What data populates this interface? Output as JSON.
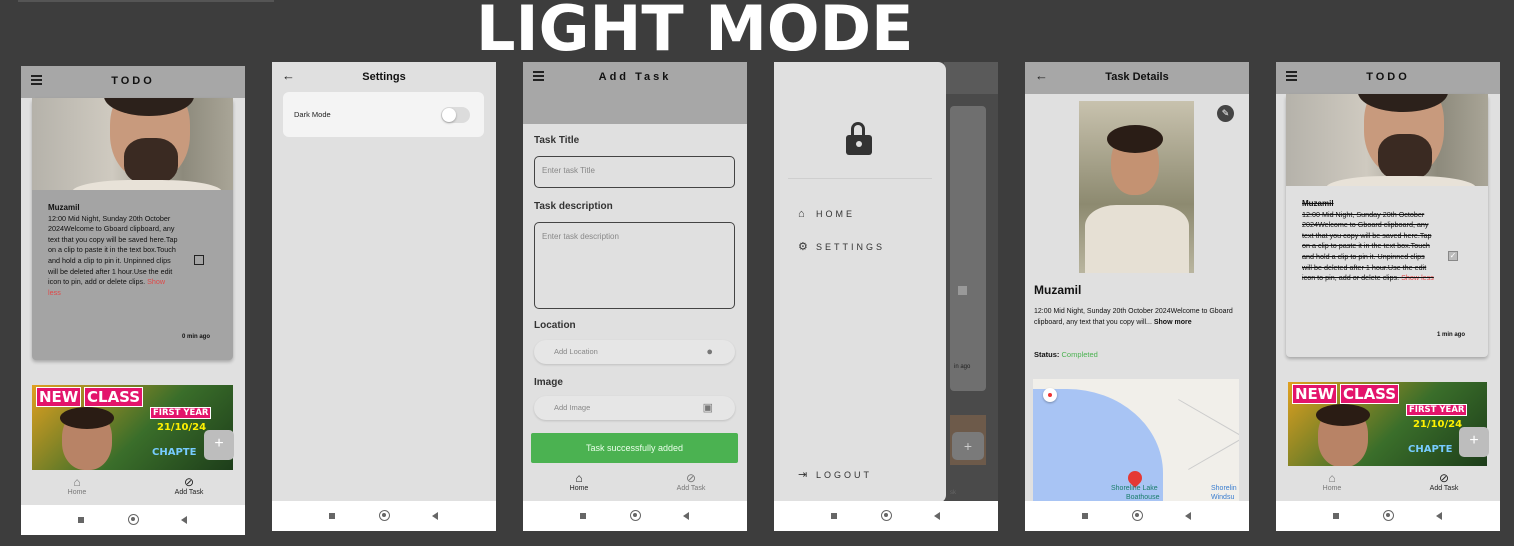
{
  "heading": "LIGHT MODE",
  "screen1": {
    "title": "TODO",
    "card": {
      "name": "Muzamil",
      "text": "12:00 Mid Night, Sunday 20th October 2024Welcome to Gboard clipboard, any text that you copy will be saved here.Tap on a clip to paste it in the text box.Touch and hold a clip to pin it. Unpinned clips will be deleted after 1 hour.Use the edit icon to pin, add or delete clips.",
      "toggle": "Show less",
      "time": "0 min ago"
    },
    "banner": {
      "w1": "NEW",
      "w2": "CLASS",
      "year": "FIRST YEAR",
      "date": "21/10/24",
      "chapter": "CHAPTE"
    },
    "fab": "+",
    "nav": {
      "home": "Home",
      "add": "Add Task"
    }
  },
  "screen2": {
    "title": "Settings",
    "dark_mode_label": "Dark Mode"
  },
  "screen3": {
    "title": "Add Task",
    "task_title_label": "Task Title",
    "task_title_placeholder": "Enter task Title",
    "desc_label": "Task description",
    "desc_placeholder": "Enter task description",
    "location_label": "Location",
    "location_placeholder": "Add Location",
    "image_label": "Image",
    "image_placeholder": "Add Image",
    "toast": "Task successfully added",
    "nav": {
      "home": "Home",
      "add": "Add Task"
    }
  },
  "screen4": {
    "home": "HOME",
    "settings": "SETTINGS",
    "logout": "LOGOUT",
    "peek_time": "in ago",
    "peek_nav": "sk"
  },
  "screen5": {
    "title": "Task Details",
    "name": "Muzamil",
    "text": "12:00 Mid Night, Sunday 20th October 2024Welcome to Gboard clipboard, any text that you copy will...",
    "show_more": "Show more",
    "status_label": "Status:",
    "status_value": "Completed",
    "map_place1": "Shoreline Lake",
    "map_place1b": "Boathouse",
    "map_place2": "Shorelin",
    "map_place2b": "Windsu"
  },
  "screen6": {
    "title": "TODO",
    "card": {
      "name": "Muzamil",
      "text": "12:00 Mid Night, Sunday 20th October 2024Welcome to Gboard clipboard, any text that you copy will be saved here.Tap on a clip to paste it in the text box.Touch and hold a clip to pin it. Unpinned clips will be deleted after 1 hour.Use the edit icon to pin, add or delete clips.",
      "toggle": "Show less",
      "time": "1 min ago"
    },
    "fab": "+",
    "nav": {
      "home": "Home",
      "add": "Add Task"
    }
  },
  "colors": {
    "background": "#3d3d3d",
    "appbar": "#a7a7a7",
    "accent_green": "#4bb251",
    "show_less": "#e04848"
  },
  "icons": [
    "menu-icon",
    "back-arrow-icon",
    "home-icon",
    "check-circle-icon",
    "location-pin-icon",
    "image-icon",
    "unlock-icon",
    "gear-icon",
    "logout-icon",
    "edit-pencil-icon"
  ]
}
